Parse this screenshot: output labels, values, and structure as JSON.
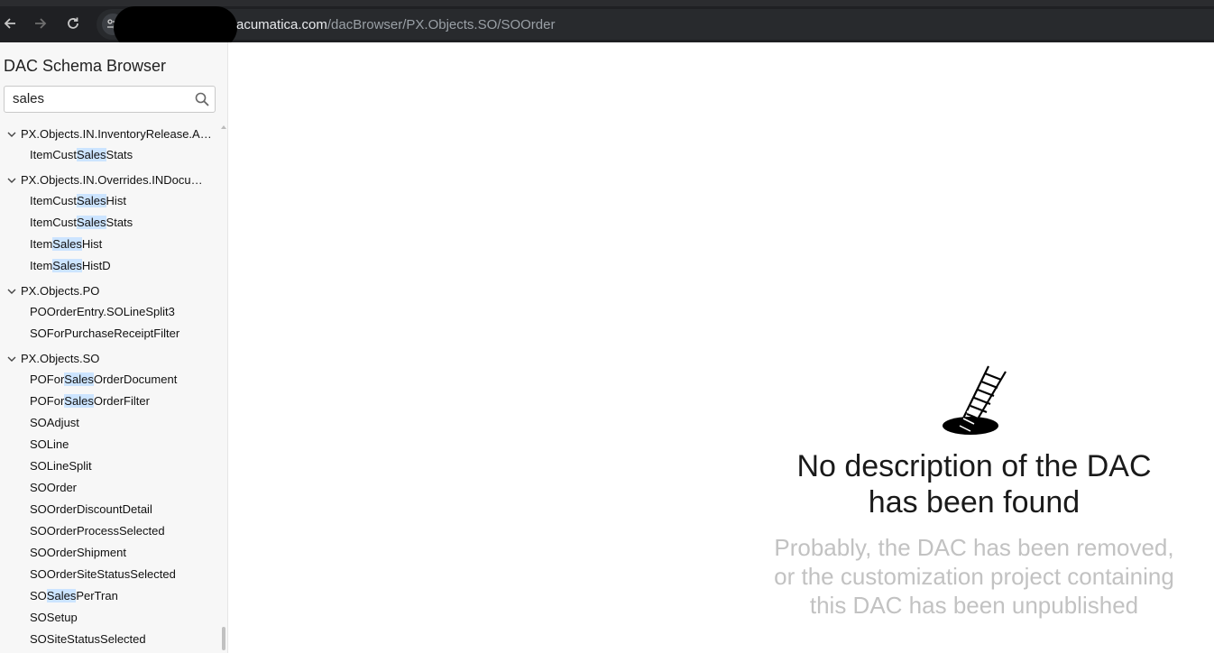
{
  "browser": {
    "url_host": "acumatica.com",
    "url_path": "/dacBrowser/PX.Objects.SO/SOOrder"
  },
  "sidebar": {
    "title": "DAC Schema Browser",
    "search_value": "sales",
    "groups": [
      {
        "label": "PX.Objects.IN.InventoryRelease.A…",
        "items": [
          {
            "pre": "ItemCust",
            "match": "Sales",
            "post": "Stats"
          }
        ]
      },
      {
        "label": "PX.Objects.IN.Overrides.INDocum…",
        "items": [
          {
            "pre": "ItemCust",
            "match": "Sales",
            "post": "Hist"
          },
          {
            "pre": "ItemCust",
            "match": "Sales",
            "post": "Stats"
          },
          {
            "pre": "Item",
            "match": "Sales",
            "post": "Hist"
          },
          {
            "pre": "Item",
            "match": "Sales",
            "post": "HistD"
          }
        ]
      },
      {
        "label": "PX.Objects.PO",
        "items": [
          {
            "pre": "POOrderEntry.SOLineSplit3",
            "match": "",
            "post": ""
          },
          {
            "pre": "SOForPurchaseReceiptFilter",
            "match": "",
            "post": ""
          }
        ]
      },
      {
        "label": "PX.Objects.SO",
        "items": [
          {
            "pre": "POFor",
            "match": "Sales",
            "post": "OrderDocument"
          },
          {
            "pre": "POFor",
            "match": "Sales",
            "post": "OrderFilter"
          },
          {
            "pre": "SOAdjust",
            "match": "",
            "post": ""
          },
          {
            "pre": "SOLine",
            "match": "",
            "post": ""
          },
          {
            "pre": "SOLineSplit",
            "match": "",
            "post": ""
          },
          {
            "pre": "SOOrder",
            "match": "",
            "post": ""
          },
          {
            "pre": "SOOrderDiscountDetail",
            "match": "",
            "post": ""
          },
          {
            "pre": "SOOrderProcessSelected",
            "match": "",
            "post": ""
          },
          {
            "pre": "SOOrderShipment",
            "match": "",
            "post": ""
          },
          {
            "pre": "SOOrderSiteStatusSelected",
            "match": "",
            "post": ""
          },
          {
            "pre": "SO",
            "match": "Sales",
            "post": "PerTran"
          },
          {
            "pre": "SOSetup",
            "match": "",
            "post": ""
          },
          {
            "pre": "SOSiteStatusSelected",
            "match": "",
            "post": ""
          }
        ]
      }
    ]
  },
  "main": {
    "empty_title_line1": "No description of the DAC",
    "empty_title_line2": "has been found",
    "empty_sub_line1": "Probably, the DAC has been removed,",
    "empty_sub_line2": "or the customization project containing",
    "empty_sub_line3": "this DAC has been unpublished"
  },
  "icons": {
    "back": "arrow-left-icon",
    "forward": "arrow-right-icon",
    "reload": "reload-icon",
    "site_info": "tune-icon",
    "search": "search-icon",
    "expand": "chevron-down-icon",
    "empty_state": "ladder-in-hole-icon"
  },
  "colors": {
    "highlight": "#cce4ff",
    "topbar": "#1f2023",
    "subtext": "#c2c2c2"
  }
}
